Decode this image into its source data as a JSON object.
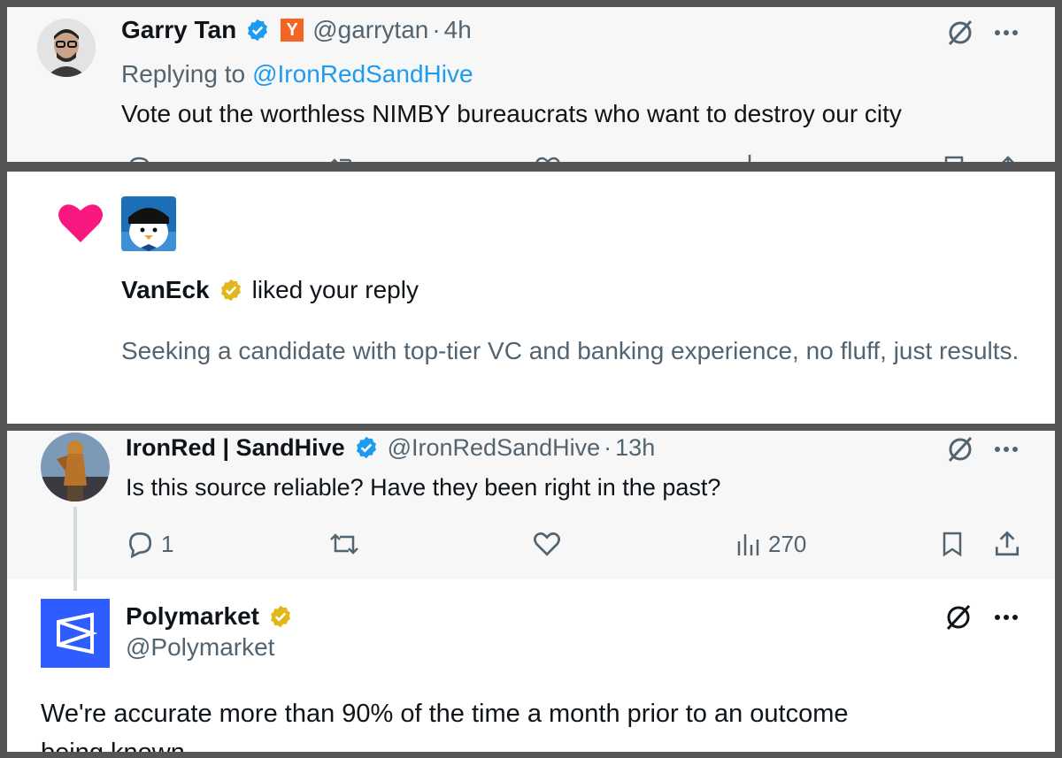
{
  "tweet1": {
    "name": "Garry Tan",
    "handle": "@garrytan",
    "separator": "·",
    "time": "4h",
    "yc_badge": "Y",
    "replying_prefix": "Replying to",
    "replying_handle": "@IronRedSandHive",
    "text": "Vote out the worthless NIMBY bureaucrats who want to destroy our city",
    "icons": [
      "grok-icon",
      "more-icon",
      "reply-icon",
      "retweet-icon",
      "like-icon",
      "views-icon",
      "bookmark-icon",
      "share-icon"
    ]
  },
  "notification": {
    "liker_name": "VanEck",
    "action": "liked your reply",
    "text": "Seeking a candidate with top-tier VC and banking experience, no fluff, just results.",
    "colors": {
      "heart": "#f91880",
      "gold_badge": "#e2b719"
    }
  },
  "tweet2": {
    "name": "IronRed | SandHive",
    "handle": "@IronRedSandHive",
    "separator": "·",
    "time": "13h",
    "text": "Is this source reliable? Have they been right in the past?",
    "reply_count": "1",
    "views": "270"
  },
  "tweet3": {
    "name": "Polymarket",
    "handle": "@Polymarket",
    "text_line1": "We're accurate more than 90% of the time a month prior to an outcome",
    "text_line2": "being known."
  },
  "colors": {
    "verified_blue": "#1d9bf0",
    "link_blue": "#1d9bf0",
    "secondary_gray": "#536471",
    "polymarket_blue": "#2e5cff"
  }
}
